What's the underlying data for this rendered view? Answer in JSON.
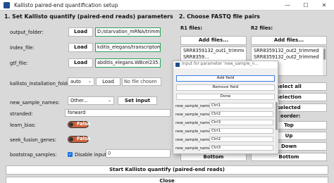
{
  "window": {
    "title": "Kallisto paired-end quantification setup",
    "minimize": "—",
    "maximize": "☐",
    "close": "✕"
  },
  "section1": {
    "title": "1. Set Kallisto quantify (paired-end reads) parameters",
    "output_folder": {
      "label": "output_folder:",
      "button": "Load",
      "value": "D:/starvation_mRNA/trimmed"
    },
    "index_file": {
      "label": "index_file:",
      "button": "Load",
      "value": "kditis_elegans/transcriptome.idx"
    },
    "gtf_file": {
      "label": "gtf_file:",
      "button": "Load",
      "value": "abditis_elegans.WBcel235.96.gtf"
    },
    "installation_folder": {
      "label": "kallisto_installation_folder:",
      "selected": "auto",
      "button": "Load",
      "file_status": "No file chosen"
    },
    "new_sample_names": {
      "label": "new_sample_names:",
      "selected": "Other...",
      "button": "Set input"
    },
    "stranded": {
      "label": "stranded:",
      "selected": "forward"
    },
    "learn_bias": {
      "label": "learn_bias:",
      "value": "False"
    },
    "seek_fusion_genes": {
      "label": "seek_fusion_genes:",
      "value": "False"
    },
    "bootstrap_samples": {
      "label": "bootstrap_samples:",
      "checkbox_label": "Disable input?",
      "checked": true,
      "value": "0"
    },
    "start_button": "Start Kallisto quantify (paired-end reads)",
    "close_button": "Close"
  },
  "section2": {
    "title": "2. Choose FASTQ file pairs",
    "r1_label": "R1 files:",
    "r2_label": "R2 files:",
    "add_files": "Add files...",
    "r1_files": [
      "SRR8359132_out1_trimmed",
      "SRR8359..."
    ],
    "r2_files": [
      "SRR8359132_out2_trimmed",
      "SRR8359132_out2_trimmed"
    ],
    "select_all": "select all",
    "clear_selection": "selection",
    "remove_selected": "selected",
    "reorder": "eorder:",
    "top": "Top",
    "up": "Up",
    "down": "Down",
    "bottom": "Bottom"
  },
  "dialog": {
    "title": "Input for parameter 'new_sample_n...",
    "add_field": "Add field",
    "remove_field": "Remove field",
    "done": "Done",
    "row_label": "new_sample_names:",
    "rows": [
      "Ctrl1",
      "Ctrl2",
      "Ctrl3",
      "Ctrl1",
      "Ctrl2",
      "Ctrl3"
    ]
  },
  "colors": {
    "background": "#d9d9d9",
    "field_border_valid": "#2aa05a",
    "toggle_off": "#c9623d",
    "checkbox_checked": "#1a73e8"
  }
}
